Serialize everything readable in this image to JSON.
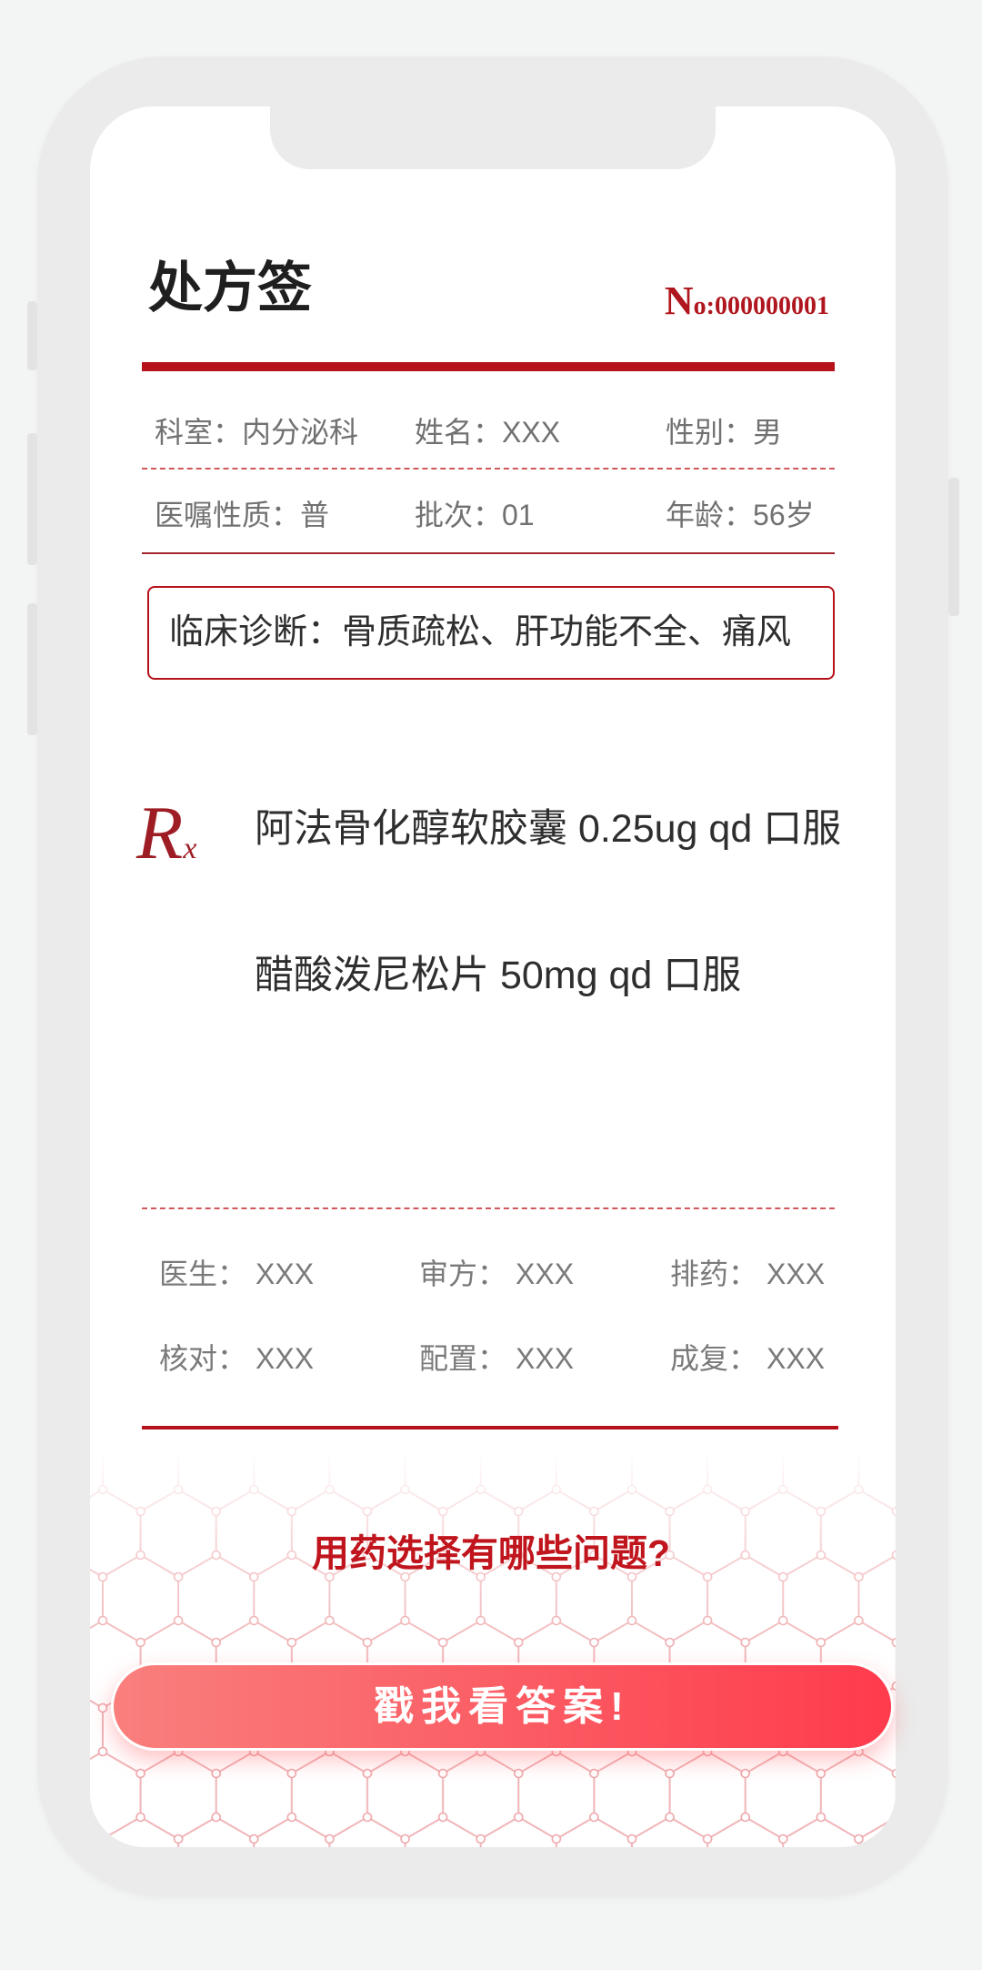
{
  "prescription": {
    "title": "处方签",
    "number": "No:000000001",
    "info_rows": [
      [
        {
          "label": "科室：",
          "value": "内分泌科"
        },
        {
          "label": "姓名：",
          "value": "XXX"
        },
        {
          "label": "性别：",
          "value": "男"
        }
      ],
      [
        {
          "label": "医嘱性质：",
          "value": "普"
        },
        {
          "label": "批次：",
          "value": "01"
        },
        {
          "label": "年龄：",
          "value": "56岁"
        }
      ]
    ],
    "diagnosis": {
      "label": "临床诊断：",
      "value": "骨质疏松、肝功能不全、痛风"
    },
    "rx_symbol": "Rx",
    "drugs": [
      "阿法骨化醇软胶囊 0.25ug qd 口服",
      "醋酸泼尼松片 50mg qd 口服"
    ],
    "staff_rows": [
      [
        {
          "label": "医生：",
          "value": "XXX"
        },
        {
          "label": "审方：",
          "value": "XXX"
        },
        {
          "label": "排药：",
          "value": "XXX"
        }
      ],
      [
        {
          "label": "核对：",
          "value": "XXX"
        },
        {
          "label": "配置：",
          "value": "XXX"
        },
        {
          "label": "成复：",
          "value": "XXX"
        }
      ]
    ]
  },
  "question": "用药选择有哪些问题?",
  "answer_button": "戳我看答案!",
  "colors": {
    "accent_red": "#b5121b",
    "question_red": "#c0151d",
    "button_gradient_start": "#f97f7d",
    "button_gradient_end": "#ff3b4d"
  }
}
